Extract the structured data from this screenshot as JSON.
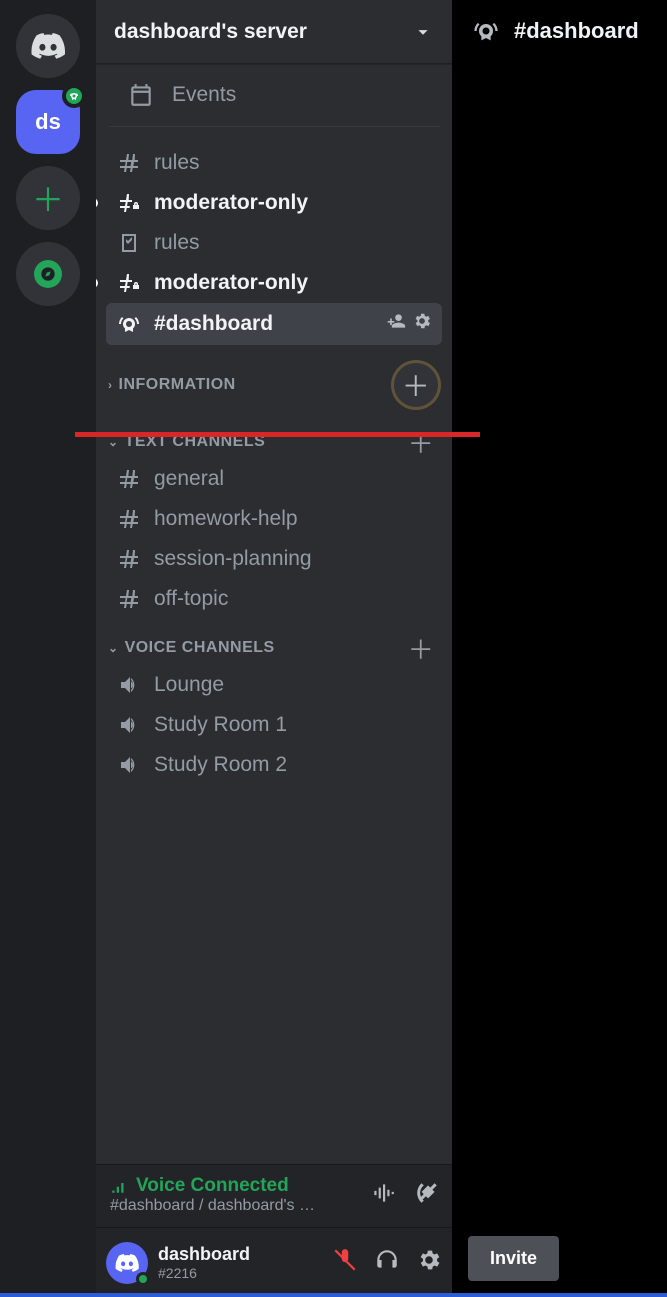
{
  "server_nav": {
    "current_server_initials": "ds"
  },
  "sidebar": {
    "server_name": "dashboard's server",
    "events_label": "Events",
    "top_channels": [
      {
        "icon": "hash",
        "name": "rules",
        "unread": false,
        "selected": false
      },
      {
        "icon": "hash-lock",
        "name": "moderator-only",
        "unread": true,
        "selected": false
      },
      {
        "icon": "rules",
        "name": "rules",
        "unread": false,
        "selected": false
      },
      {
        "icon": "hash-lock",
        "name": "moderator-only",
        "unread": true,
        "selected": false
      },
      {
        "icon": "stage",
        "name": "#dashboard",
        "unread": false,
        "selected": true
      }
    ],
    "categories": [
      {
        "label": "INFORMATION",
        "collapsed": true,
        "add_style": "pulse",
        "channels": []
      },
      {
        "label": "TEXT CHANNELS",
        "collapsed": false,
        "add_style": "plain",
        "channels": [
          {
            "icon": "hash",
            "name": "general"
          },
          {
            "icon": "hash",
            "name": "homework-help"
          },
          {
            "icon": "hash",
            "name": "session-planning"
          },
          {
            "icon": "hash",
            "name": "off-topic"
          }
        ]
      },
      {
        "label": "VOICE CHANNELS",
        "collapsed": false,
        "add_style": "plain",
        "channels": [
          {
            "icon": "speaker",
            "name": "Lounge"
          },
          {
            "icon": "speaker",
            "name": "Study Room 1"
          },
          {
            "icon": "speaker",
            "name": "Study Room 2"
          }
        ]
      }
    ]
  },
  "voice": {
    "status": "Voice Connected",
    "subtext": "#dashboard / dashboard's …"
  },
  "user": {
    "name": "dashboard",
    "tag": "#2216"
  },
  "main": {
    "channel_name": "#dashboard",
    "invite_label": "Invite"
  }
}
